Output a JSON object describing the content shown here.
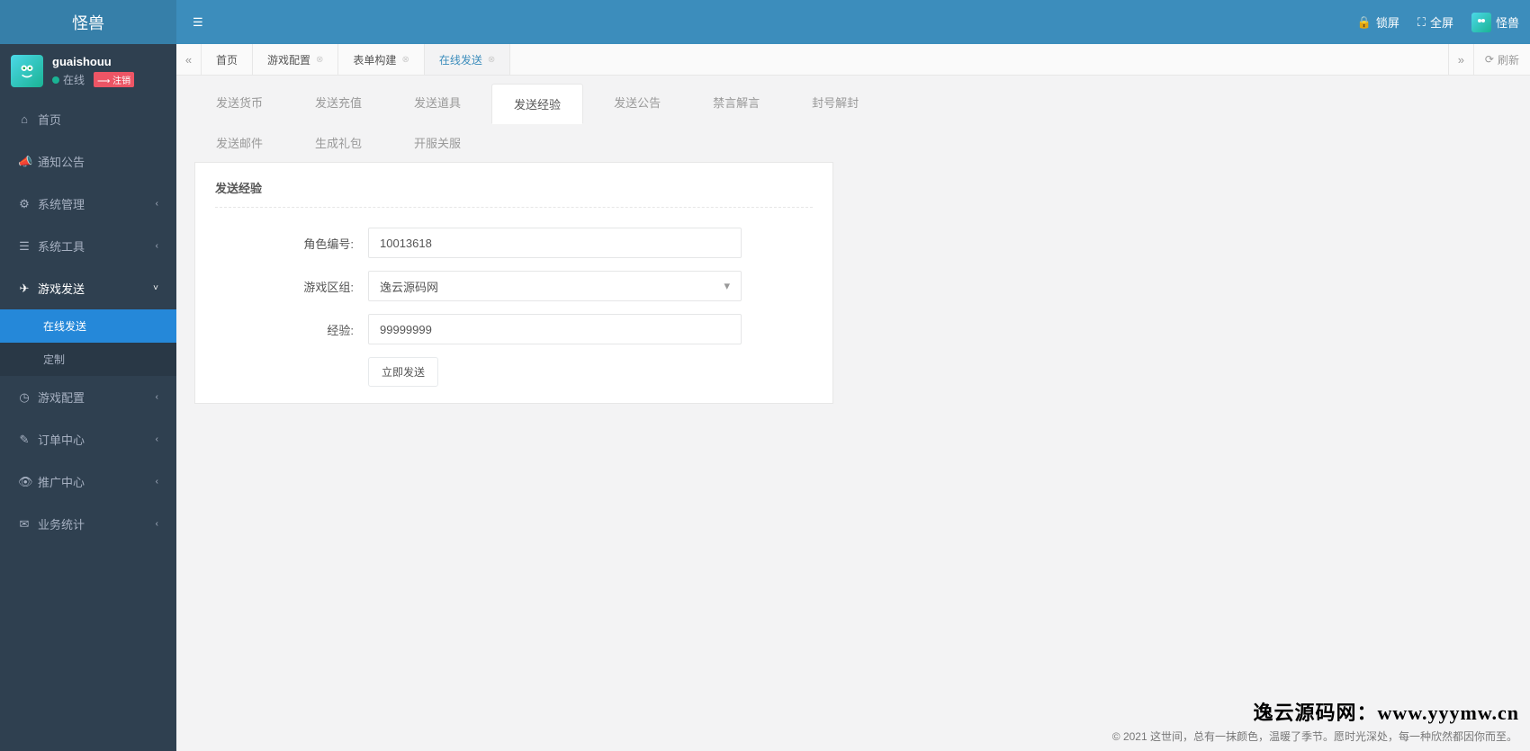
{
  "brand": "怪兽",
  "user": {
    "name": "guaishouu",
    "status": "在线",
    "logout": "注销"
  },
  "sidebar": {
    "items": [
      {
        "icon": "home",
        "label": "首页",
        "expandable": false
      },
      {
        "icon": "bullhorn",
        "label": "通知公告",
        "expandable": false
      },
      {
        "icon": "cog",
        "label": "系统管理",
        "expandable": true
      },
      {
        "icon": "list",
        "label": "系统工具",
        "expandable": true
      },
      {
        "icon": "send",
        "label": "游戏发送",
        "expandable": true,
        "open": true,
        "children": [
          {
            "label": "在线发送",
            "current": true
          },
          {
            "label": "定制"
          }
        ]
      },
      {
        "icon": "dashboard",
        "label": "游戏配置",
        "expandable": true
      },
      {
        "icon": "pencil",
        "label": "订单中心",
        "expandable": true
      },
      {
        "icon": "eye",
        "label": "推广中心",
        "expandable": true
      },
      {
        "icon": "envelope",
        "label": "业务统计",
        "expandable": true
      }
    ]
  },
  "topbar": {
    "lock": "锁屏",
    "fullscreen": "全屏",
    "username": "怪兽"
  },
  "tabstrip": {
    "refresh": "刷新",
    "tabs": [
      {
        "label": "首页"
      },
      {
        "label": "游戏配置",
        "closable": true
      },
      {
        "label": "表单构建",
        "closable": true
      },
      {
        "label": "在线发送",
        "closable": true,
        "active": true
      }
    ]
  },
  "inner_tabs": [
    {
      "label": "发送货币"
    },
    {
      "label": "发送充值"
    },
    {
      "label": "发送道具"
    },
    {
      "label": "发送经验",
      "active": true
    },
    {
      "label": "发送公告"
    },
    {
      "label": "禁言解言"
    },
    {
      "label": "封号解封"
    },
    {
      "label": "发送邮件"
    },
    {
      "label": "生成礼包"
    },
    {
      "label": "开服关服"
    }
  ],
  "panel": {
    "title": "发送经验",
    "role_label": "角色编号:",
    "role_value": "10013618",
    "zone_label": "游戏区组:",
    "zone_value": "逸云源码网",
    "exp_label": "经验:",
    "exp_value": "99999999",
    "submit": "立即发送"
  },
  "watermark": "逸云源码网：www.yyymw.cn",
  "footer": "© 2021 这世间，总有一抹颜色，温暖了季节。愿时光深处，每一种欣然都因你而至。"
}
